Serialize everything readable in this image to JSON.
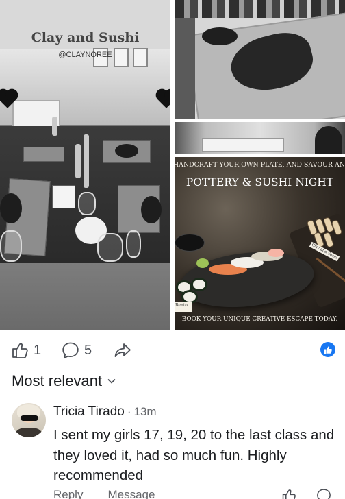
{
  "post_images": {
    "left": {
      "title": "Clay and Sushi",
      "handle": "@CLAYNOREE"
    },
    "advertisement": {
      "tagline": "HANDCRAFT YOUR OWN PLATE, AND SAVOUR AN ARTFUL BITE",
      "title": "POTTERY & SUSHI NIGHT",
      "cta": "BOOK YOUR UNIQUE CREATIVE ESCAPE TODAY.",
      "card_label": "Bento",
      "box_label": "Clay and Sushi"
    }
  },
  "actions": {
    "like_count": "1",
    "comment_count": "5",
    "like_icon": "thumbs-up-icon",
    "comment_icon": "comment-bubble-icon",
    "share_icon": "share-arrow-icon",
    "reaction_badge_icon": "like-reaction-icon",
    "reaction_color": "#1877f2"
  },
  "comments": {
    "sort_label": "Most relevant",
    "items": [
      {
        "author": "Tricia Tirado",
        "separator": "·",
        "time": "13m",
        "text": "I sent my girls 17, 19, 20 to the last class and they loved it, had so much fun. Highly recommended",
        "reply_label": "Reply",
        "message_label": "Message"
      }
    ]
  }
}
